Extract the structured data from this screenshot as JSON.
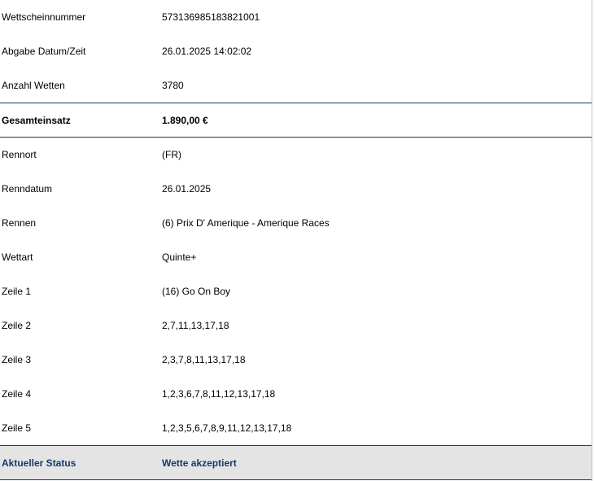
{
  "ticket": {
    "wettscheinnummer": {
      "label": "Wettscheinnummer",
      "value": "573136985183821001"
    },
    "abgabe": {
      "label": "Abgabe Datum/Zeit",
      "value": "26.01.2025 14:02:02"
    },
    "anzahl": {
      "label": "Anzahl Wetten",
      "value": "3780"
    },
    "gesamteinsatz": {
      "label": "Gesamteinsatz",
      "value": "1.890,00 €"
    },
    "rennort": {
      "label": "Rennort",
      "value": "(FR)"
    },
    "renndatum": {
      "label": "Renndatum",
      "value": "26.01.2025"
    },
    "rennen": {
      "label": "Rennen",
      "value": "(6) Prix D' Amerique - Amerique Races"
    },
    "wettart": {
      "label": "Wettart",
      "value": "Quinte+"
    },
    "zeilen": [
      {
        "label": "Zeile 1",
        "value": "(16) Go On Boy"
      },
      {
        "label": "Zeile 2",
        "value": "2,7,11,13,17,18"
      },
      {
        "label": "Zeile 3",
        "value": "2,3,7,8,11,13,17,18"
      },
      {
        "label": "Zeile 4",
        "value": "1,2,3,6,7,8,11,12,13,17,18"
      },
      {
        "label": "Zeile 5",
        "value": "1,2,3,5,6,7,8,9,11,12,13,17,18"
      }
    ],
    "status": {
      "label": "Aktueller Status",
      "value": "Wette akzeptiert"
    }
  },
  "colors": {
    "divider": "#1a3a5c",
    "status_text": "#17386e",
    "status_background": "#e4e4e4"
  }
}
